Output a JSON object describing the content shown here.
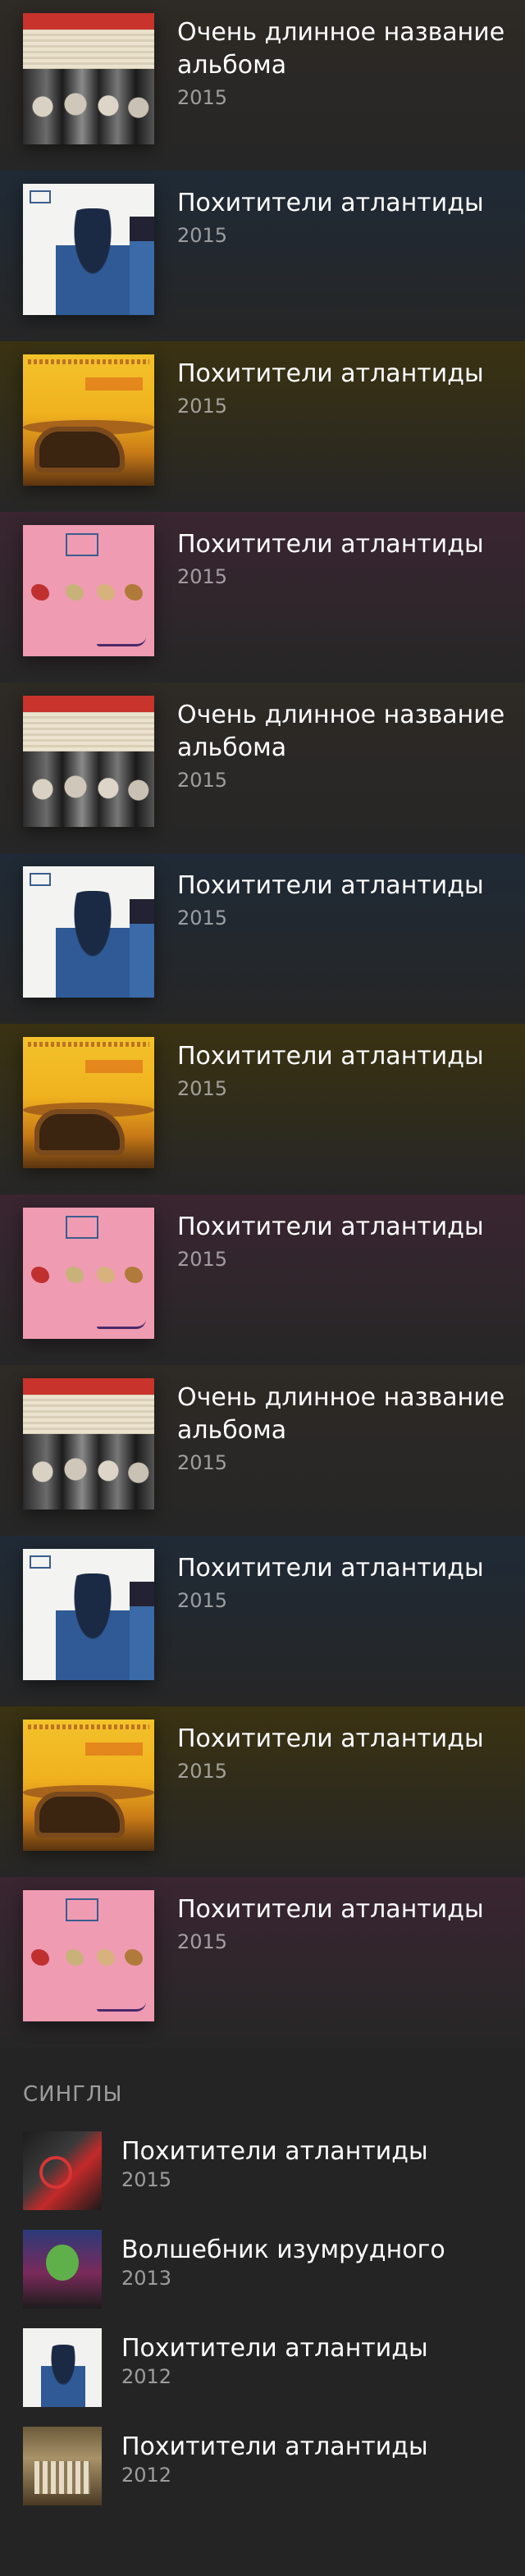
{
  "albums": [
    {
      "title": "Очень длинное название альбома",
      "year": "2015",
      "art": "art-1",
      "bg": "#2e2a25"
    },
    {
      "title": "Похитители атлантиды",
      "year": "2015",
      "art": "art-2",
      "bg": "#1f2a36"
    },
    {
      "title": "Похитители атлантиды",
      "year": "2015",
      "art": "art-3",
      "bg": "#3a3211"
    },
    {
      "title": "Похитители атлантиды",
      "year": "2015",
      "art": "art-4",
      "bg": "#3a2531"
    },
    {
      "title": "Очень длинное название альбома",
      "year": "2015",
      "art": "art-1",
      "bg": "#2e2a25"
    },
    {
      "title": "Похитители атлантиды",
      "year": "2015",
      "art": "art-2",
      "bg": "#1f2a36"
    },
    {
      "title": "Похитители атлантиды",
      "year": "2015",
      "art": "art-3",
      "bg": "#3a3211"
    },
    {
      "title": "Похитители атлантиды",
      "year": "2015",
      "art": "art-4",
      "bg": "#3a2531"
    },
    {
      "title": "Очень длинное название альбома",
      "year": "2015",
      "art": "art-1",
      "bg": "#2e2a25"
    },
    {
      "title": "Похитители атлантиды",
      "year": "2015",
      "art": "art-2",
      "bg": "#1f2a36"
    },
    {
      "title": "Похитители атлантиды",
      "year": "2015",
      "art": "art-3",
      "bg": "#3a3211"
    },
    {
      "title": "Похитители атлантиды",
      "year": "2015",
      "art": "art-4",
      "bg": "#3a2531"
    }
  ],
  "singles": {
    "section_title": "СИНГЛЫ",
    "items": [
      {
        "title": "Похитители атлантиды",
        "year": "2015",
        "art": "sa-1"
      },
      {
        "title": "Волшебник изумрудного",
        "year": "2013",
        "art": "sa-2"
      },
      {
        "title": "Похитители атлантиды",
        "year": "2012",
        "art": "sa-3"
      },
      {
        "title": "Похитители атлантиды",
        "year": "2012",
        "art": "sa-4"
      }
    ]
  }
}
